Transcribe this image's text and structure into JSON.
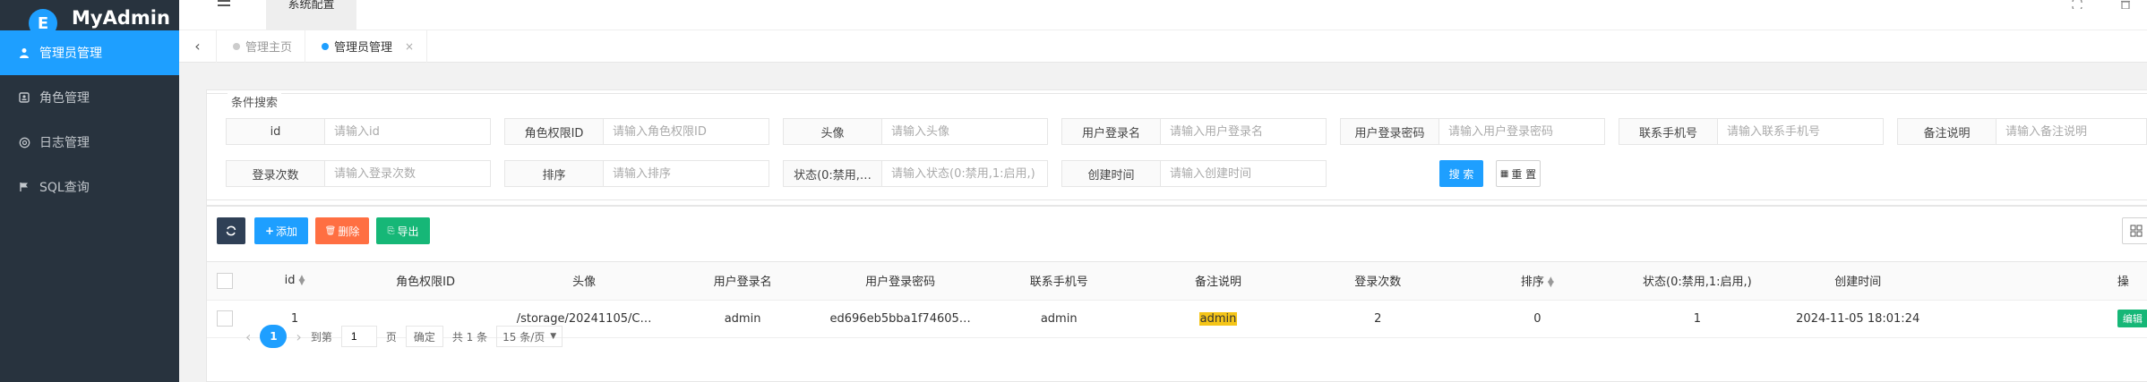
{
  "app": {
    "name": "MyAdmin",
    "logo_letter": "E"
  },
  "sidebar": {
    "items": [
      {
        "label": "管理员管理",
        "icon": "user-icon",
        "active": true
      },
      {
        "label": "角色管理",
        "icon": "role-icon",
        "active": false
      },
      {
        "label": "日志管理",
        "icon": "log-icon",
        "active": false
      },
      {
        "label": "SQL查询",
        "icon": "sql-icon",
        "active": false
      }
    ]
  },
  "header": {
    "tab_label": "系统配置"
  },
  "tabs": {
    "items": [
      {
        "label": "管理主页",
        "active": false
      },
      {
        "label": "管理员管理",
        "active": true
      }
    ],
    "close_symbol": "×"
  },
  "search": {
    "legend": "条件搜索",
    "fields": [
      {
        "label": "id",
        "placeholder": "请输入id"
      },
      {
        "label": "角色权限ID",
        "placeholder": "请输入角色权限ID"
      },
      {
        "label": "头像",
        "placeholder": "请输入头像"
      },
      {
        "label": "用户登录名",
        "placeholder": "请输入用户登录名"
      },
      {
        "label": "用户登录密码",
        "placeholder": "请输入用户登录密码"
      },
      {
        "label": "联系手机号",
        "placeholder": "请输入联系手机号"
      },
      {
        "label": "备注说明",
        "placeholder": "请输入备注说明"
      },
      {
        "label": "登录次数",
        "placeholder": "请输入登录次数"
      },
      {
        "label": "排序",
        "placeholder": "请输入排序"
      },
      {
        "label": "状态(0:禁用,…",
        "placeholder": "请输入状态(0:禁用,1:启用,)"
      },
      {
        "label": "创建时间",
        "placeholder": "请输入创建时间"
      }
    ],
    "search_label": "搜 索",
    "reset_label": "重 置"
  },
  "toolbar": {
    "add_label": "添加",
    "delete_label": "删除",
    "export_label": "导出"
  },
  "table": {
    "columns": [
      "id",
      "角色权限ID",
      "头像",
      "用户登录名",
      "用户登录密码",
      "联系手机号",
      "备注说明",
      "登录次数",
      "排序",
      "状态(0:禁用,1:启用,)",
      "创建时间",
      "操"
    ],
    "rows": [
      {
        "id": "1",
        "role_id": "",
        "avatar": "/storage/20241105/C…",
        "username": "admin",
        "password": "ed696eb5bba1f74605…",
        "phone": "admin",
        "remark": "admin",
        "login_count": "2",
        "sort": "0",
        "status": "1",
        "created_at": "2024-11-05 18:01:24",
        "action": "编辑"
      }
    ]
  },
  "pager": {
    "current": "1",
    "goto_label": "到第",
    "goto_value": "1",
    "page_unit": "页",
    "confirm_label": "确定",
    "total_label": "共 1 条",
    "page_size": "15 条/页"
  }
}
